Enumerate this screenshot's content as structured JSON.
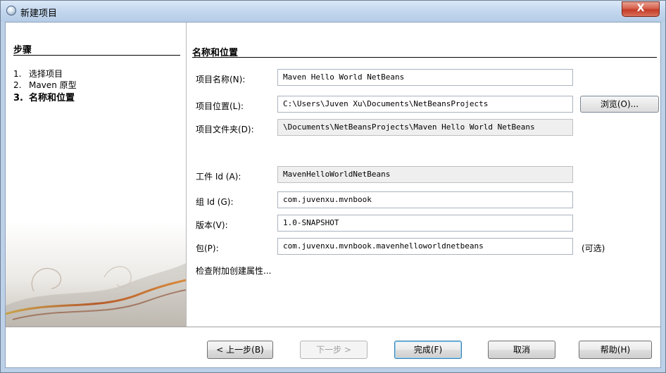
{
  "window": {
    "title": "新建项目",
    "close_label": "X"
  },
  "steps": {
    "heading": "步骤",
    "items": [
      {
        "num": "1.",
        "label": "选择项目"
      },
      {
        "num": "2.",
        "label": "Maven 原型"
      },
      {
        "num": "3.",
        "label": "名称和位置"
      }
    ]
  },
  "section": {
    "title": "名称和位置"
  },
  "form": {
    "project_name": {
      "label": "项目名称(N):",
      "value": "Maven Hello World NetBeans"
    },
    "project_location": {
      "label": "项目位置(L):",
      "value": "C:\\Users\\Juven Xu\\Documents\\NetBeansProjects",
      "browse_label": "浏览(O)..."
    },
    "project_folder": {
      "label": "项目文件夹(D):",
      "value": "\\Documents\\NetBeansProjects\\Maven Hello World NetBeans"
    },
    "artifact_id": {
      "label": "工件 Id (A):",
      "value": "MavenHelloWorldNetBeans"
    },
    "group_id": {
      "label": "组 Id (G):",
      "value": "com.juvenxu.mvnbook"
    },
    "version": {
      "label": "版本(V):",
      "value": "1.0-SNAPSHOT"
    },
    "package": {
      "label": "包(P):",
      "value": "com.juvenxu.mvnbook.mavenhelloworldnetbeans",
      "optional": "(可选)"
    },
    "advanced": "检查附加创建属性..."
  },
  "buttons": {
    "back": "< 上一步(B)",
    "next": "下一步 >",
    "finish": "完成(F)",
    "cancel": "取消",
    "help": "帮助(H)"
  }
}
